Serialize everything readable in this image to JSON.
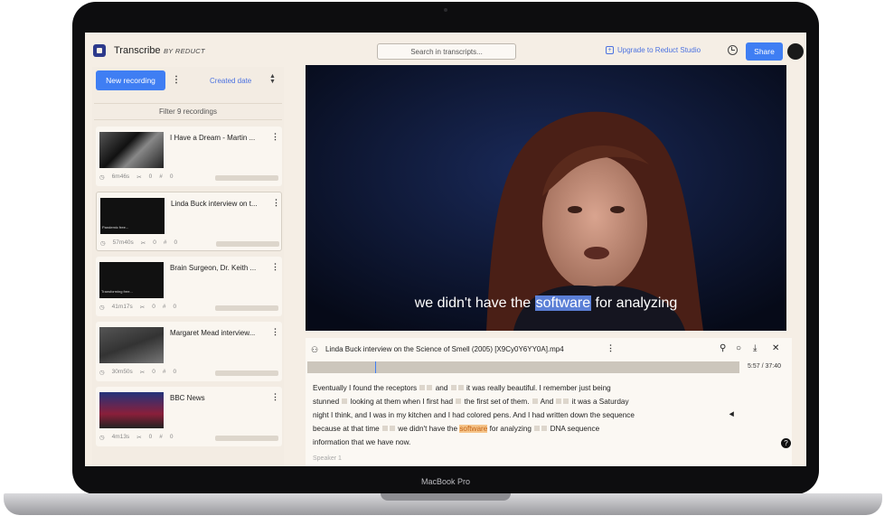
{
  "app": {
    "title": "Transcribe",
    "subtitle": "BY REDUCT",
    "search_placeholder": "Search in transcripts...",
    "upgrade_label": "Upgrade to Reduct Studio",
    "share_label": "Share"
  },
  "device": {
    "label": "MacBook Pro"
  },
  "sidebar": {
    "new_recording_label": "New recording",
    "sort_label": "Created date",
    "filter_label": "Filter 9 recordings",
    "recordings": [
      {
        "title": "I Have a Dream - Martin ...",
        "duration": "6m46s",
        "clips": "0",
        "highlights": "0"
      },
      {
        "title": "Linda Buck interview on t...",
        "duration": "57m40s",
        "clips": "0",
        "highlights": "0",
        "thumb_caption": "Pandemic free..."
      },
      {
        "title": "Brain Surgeon, Dr. Keith ...",
        "duration": "41m17s",
        "clips": "0",
        "highlights": "0",
        "thumb_caption": "Transforming free..."
      },
      {
        "title": "Margaret Mead interview...",
        "duration": "30m50s",
        "clips": "0",
        "highlights": "0"
      },
      {
        "title": "BBC News",
        "duration": "4m13s",
        "clips": "0",
        "highlights": "0"
      }
    ]
  },
  "video": {
    "caption_before": "we didn't have the ",
    "caption_highlight": "software",
    "caption_after": " for analyzing"
  },
  "transcript": {
    "file_name": "Linda Buck interview on the Science of Smell (2005) [X9Cy0Y6YY0A].mp4",
    "timecode": "5:57 / 37:40",
    "speaker": "Speaker 1",
    "lines": {
      "l1a": "Eventually I found the receptors",
      "l1b": "and",
      "l1c": "it was really beautiful. I remember just being",
      "l2a": "stunned",
      "l2b": "looking at them when I first had",
      "l2c": "the first set of them.",
      "l2d": "And",
      "l2e": "it was a Saturday",
      "l3": "night I think, and I was in my kitchen and I had colored pens. And I had written down the sequence",
      "l4a": "because at that time",
      "l4b": "we didn't have the",
      "l4c": "software",
      "l4d": "for analyzing",
      "l4e": "DNA sequence",
      "l5": "information that we have now."
    }
  },
  "colors": {
    "accent": "#3f7ef3",
    "highlight": "#f6c58a",
    "caption_highlight": "#5b7fd6"
  }
}
